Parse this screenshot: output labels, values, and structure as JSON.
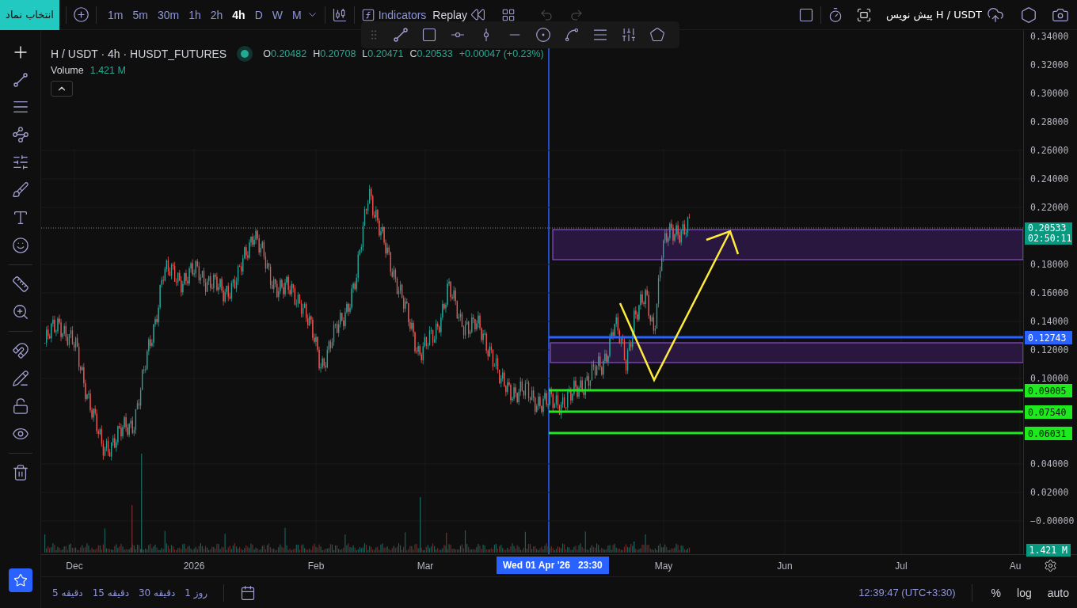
{
  "top_bar": {
    "symbol_button": "انتخاب نماد",
    "timeframes": [
      {
        "label": "1m",
        "selected": false
      },
      {
        "label": "5m",
        "selected": false
      },
      {
        "label": "30m",
        "selected": false
      },
      {
        "label": "1h",
        "selected": false
      },
      {
        "label": "2h",
        "selected": false
      },
      {
        "label": "4h",
        "selected": true
      },
      {
        "label": "D",
        "selected": false
      },
      {
        "label": "W",
        "selected": false
      },
      {
        "label": "M",
        "selected": false
      }
    ],
    "indicators_label": "Indicators",
    "replay_label": "Replay",
    "draft_label": "پیش نویس H / USDT"
  },
  "legend": {
    "title": "H / USDT · 4h · HUSDT_FUTURES",
    "ohlc": [
      {
        "key": "O",
        "value": "0.20482"
      },
      {
        "key": "H",
        "value": "0.20708"
      },
      {
        "key": "L",
        "value": "0.20471"
      },
      {
        "key": "C",
        "value": "0.20533"
      }
    ],
    "change": "+0.00047 (+0.23%)",
    "volume_label": "Volume",
    "volume_value": "1.421 M"
  },
  "price_axis": {
    "labels": [
      "0.34000",
      "0.32000",
      "0.30000",
      "0.28000",
      "0.26000",
      "0.24000",
      "0.22000",
      "0.18000",
      "0.16000",
      "0.14000",
      "0.12000",
      "0.10000",
      "0.04000",
      "0.02000",
      "−0.00000"
    ],
    "current_price": "0.20533",
    "countdown": "02:50:11",
    "markers": [
      {
        "label": "0.12743",
        "color": "#2962ff"
      },
      {
        "label": "0.09005",
        "color": "#1ee81e"
      },
      {
        "label": "0.07540",
        "color": "#1ee81e"
      },
      {
        "label": "0.06031",
        "color": "#1ee81e"
      }
    ],
    "volume_marker": "1.421 M"
  },
  "time_axis": {
    "labels": [
      "Dec",
      "2026",
      "Feb",
      "Mar",
      "May",
      "Jun",
      "Jul",
      "Au"
    ],
    "crosshair_date": "Wed 01 Apr '26",
    "crosshair_time": "23:30"
  },
  "bottom_bar": {
    "ranges": [
      "1 روز",
      "30 دقیقه",
      "15 دقیقه",
      "5 دقیقه"
    ],
    "clock": "12:39:47 (UTC+3:30)",
    "percent": "%",
    "log": "log",
    "auto": "auto"
  }
}
